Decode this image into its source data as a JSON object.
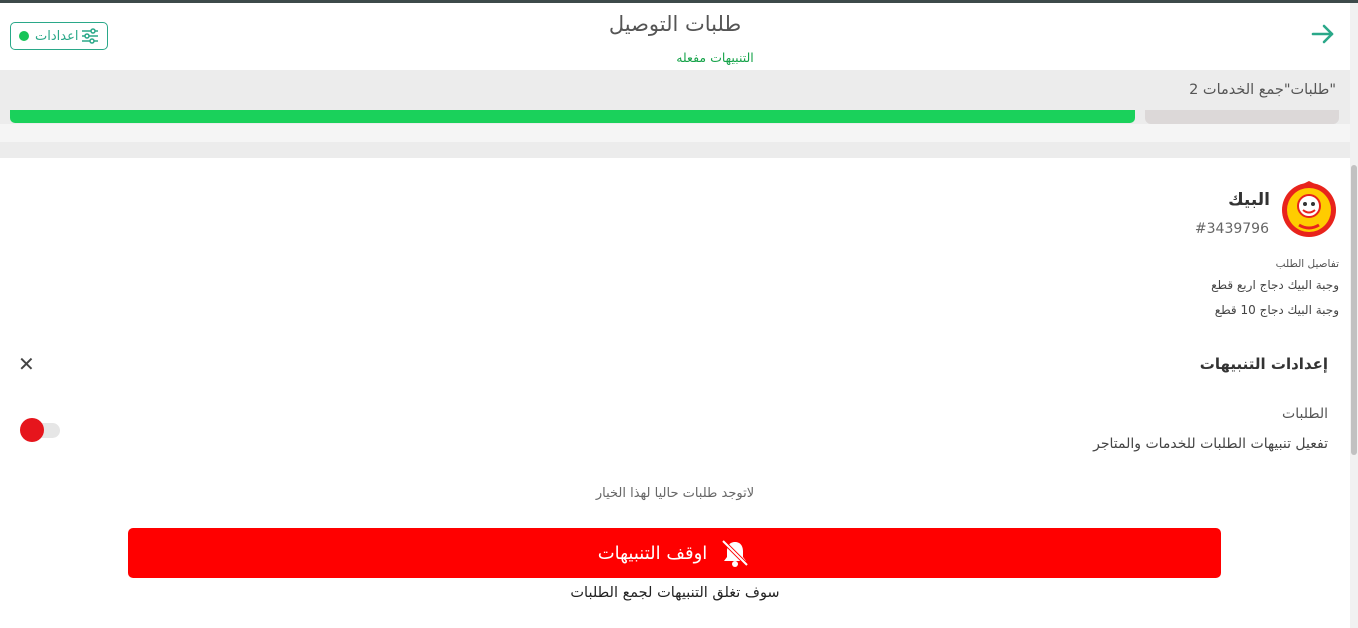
{
  "header": {
    "title": "طلبات التوصيل",
    "subtitle": "التنبيهات مفعله",
    "settings_label": "اعدادات",
    "back_icon": "arrow-right-icon",
    "settings_icon": "sliders-icon",
    "status_dot_color": "#16c458",
    "accent_color": "#2aa889"
  },
  "band": {
    "title": "\"طلبات\"جمع الخدمات 2"
  },
  "order": {
    "restaurant": "البيك",
    "order_number": "#3439796",
    "details_label": "تفاصيل الطلب",
    "items": [
      "وجبة البيك دجاج اربع قطع",
      "وجبة البيك دجاج 10 قطع"
    ],
    "logo_text": "البيك"
  },
  "notification_settings": {
    "title": "إعدادات التنبيهات",
    "close_icon": "close-icon",
    "orders_label": "الطلبات",
    "orders_description": "تفعيل تنبيهات الطلبات للخدمات والمتاجر",
    "toggle_on": false,
    "empty_message": "لاتوجد طلبات حاليا لهذا الخيار"
  },
  "stop_button": {
    "label": "اوقف التنبيهات",
    "icon": "bell-slash-icon",
    "color": "#ff0000"
  },
  "footer_note": "سوف تغلق التنبيهات لجمع الطلبات"
}
